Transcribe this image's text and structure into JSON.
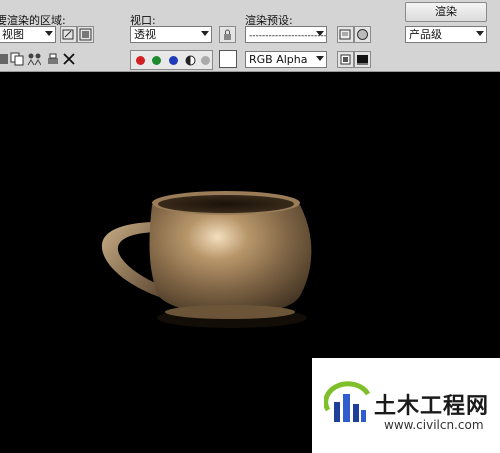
{
  "header": {
    "area_label": "要渲染的区域:",
    "area_value": "视图",
    "viewport_label": "视口:",
    "viewport_value": "透视",
    "preset_label": "渲染预设:",
    "preset_value": "-------------------------",
    "render_button": "渲染",
    "quality_value": "产品级"
  },
  "toolbar": {
    "channel_value": "RGB Alpha",
    "channel_colors": {
      "red": "#d42020",
      "green": "#1e8a2e",
      "blue": "#1f3bb8"
    }
  },
  "viewport": {
    "background": "#000000",
    "object_color": "#8b7250"
  },
  "watermark": {
    "title": "土木工程网",
    "url": "www.civilcn.com"
  }
}
